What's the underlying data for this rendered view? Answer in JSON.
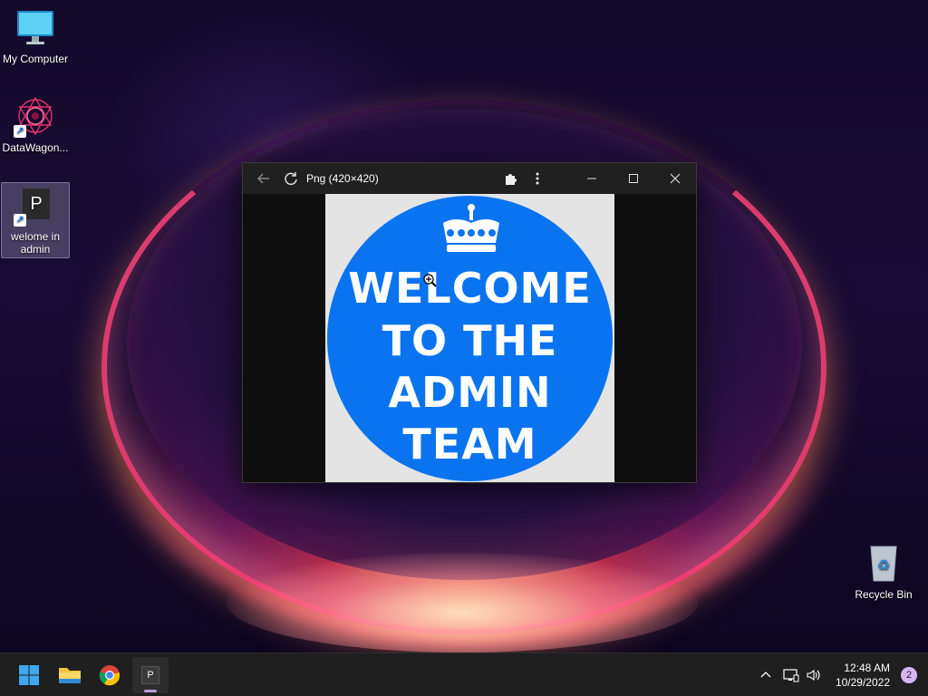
{
  "desktop": {
    "icons": [
      {
        "label": "My Computer",
        "icon": "monitor-icon"
      },
      {
        "label": "DataWagon...",
        "icon": "datawagon-app-icon"
      },
      {
        "label": "welome in admin",
        "icon": "p-file-icon",
        "glyph_letter": "P"
      },
      {
        "label": "Recycle Bin",
        "icon": "recycle-bin-icon"
      }
    ]
  },
  "window": {
    "title": "Png (420×420)",
    "back_icon": "back-arrow-icon",
    "reload_icon": "reload-icon",
    "extensions_icon": "puzzle-icon",
    "menu_icon": "kebab-menu-icon",
    "minimize_icon": "minimize-icon",
    "maximize_icon": "maximize-icon",
    "close_icon": "close-icon"
  },
  "image": {
    "lines": [
      "WELCOME",
      "TO THE",
      "ADMIN",
      "TEAM"
    ],
    "crown_icon": "crown-icon",
    "circle_color": "#0a74f0",
    "text_color": "#ffffff"
  },
  "taskbar": {
    "items": [
      {
        "name": "start-button",
        "icon": "windows-logo-icon"
      },
      {
        "name": "file-explorer-button",
        "icon": "folder-icon"
      },
      {
        "name": "chrome-button",
        "icon": "chrome-icon"
      },
      {
        "name": "image-viewer-button",
        "icon": "p-app-icon",
        "glyph_letter": "P"
      }
    ],
    "tray": {
      "chevron_icon": "chevron-up-icon",
      "network_icon": "network-icon",
      "volume_icon": "volume-icon"
    },
    "clock": {
      "time": "12:48 AM",
      "date": "10/29/2022"
    },
    "notification_count": "2"
  }
}
